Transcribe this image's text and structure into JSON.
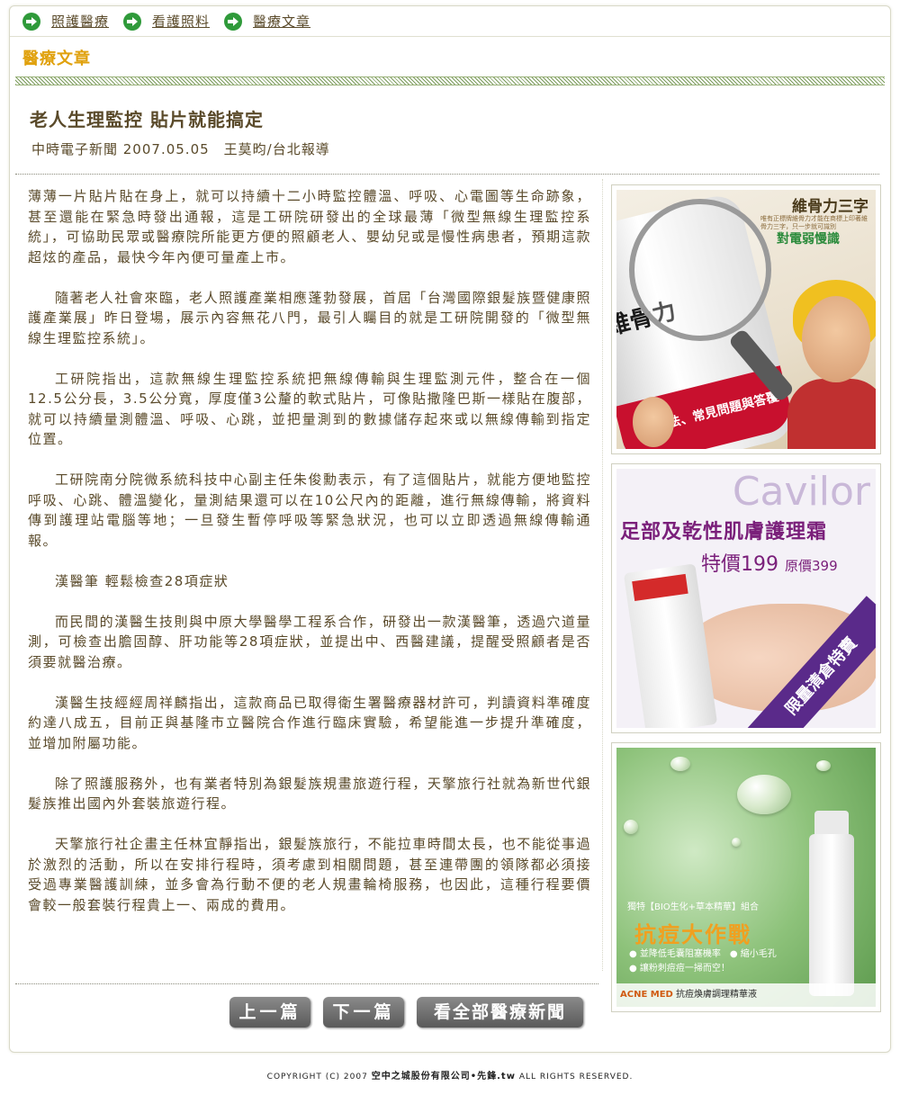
{
  "nav": {
    "items": [
      {
        "label": "照護醫療"
      },
      {
        "label": "看護照料"
      },
      {
        "label": "醫療文章"
      }
    ]
  },
  "section_title": "醫療文章",
  "article": {
    "title": "老人生理監控 貼片就能搞定",
    "byline": "中時電子新聞 2007.05.05　王莫昀/台北報導",
    "paragraphs": [
      "薄薄一片貼片貼在身上，就可以持續十二小時監控體溫、呼吸、心電圖等生命跡象，甚至還能在緊急時發出通報，這是工研院研發出的全球最薄「微型無線生理監控系統」，可協助民眾或醫療院所能更方便的照顧老人、嬰幼兒或是慢性病患者，預期這款超炫的產品，最快今年內便可量產上市。",
      "隨著老人社會來臨，老人照護產業相應蓬勃發展，首屆「台灣國際銀髮族暨健康照護產業展」昨日登場，展示內容無花八門，最引人矚目的就是工研院開發的「微型無線生理監控系統」。",
      "工研院指出，這款無線生理監控系統把無線傳輸與生理監測元件，整合在一個12.5公分長，3.5公分寬，厚度僅3公釐的軟式貼片，可像貼撒隆巴斯一樣貼在腹部，就可以持續量測體溫、呼吸、心跳，並把量測到的數據儲存起來或以無線傳輸到指定位置。",
      "工研院南分院微系統科技中心副主任朱俊勳表示，有了這個貼片，就能方便地監控呼吸、心跳、體溫變化，量測結果還可以在10公尺內的距離，進行無線傳輸，將資料傳到護理站電腦等地；一旦發生暫停呼吸等緊急狀況，也可以立即透過無線傳輸通報。",
      "漢醫筆 輕鬆檢查28項症狀",
      "而民間的漢醫生技則與中原大學醫學工程系合作，研發出一款漢醫筆，透過穴道量測，可檢查出膽固醇、肝功能等28項症狀，並提出中、西醫建議，提醒受照顧者是否須要就醫治療。",
      "漢醫生技經經周祥麟指出，這款商品已取得衛生署醫療器材許可，判讀資料準確度約達八成五，目前正與基隆市立醫院合作進行臨床實驗，希望能進一步提升準確度，並增加附屬功能。",
      "除了照護服務外，也有業者特別為銀髮族規畫旅遊行程，天擎旅行社就為新世代銀髮族推出國內外套裝旅遊行程。",
      "天擎旅行社企畫主任林宜靜指出，銀髮族旅行，不能拉車時間太長，也不能從事過於激烈的活動，所以在安排行程時，須考慮到相關問題，甚至連帶團的領隊都必須接受過專業醫護訓練，並多會為行動不便的老人規畫輪椅服務，也因此，這種行程要價會較一般套裝行程貴上一、兩成的費用。"
    ]
  },
  "ads": {
    "ad1": {
      "headline": "維骨力三字",
      "fine_print": "唯有正標牌維骨力才能在商標上印著維骨力三字，只一步就可識別",
      "subhead": "對電弱慢識",
      "bottle_brand": "維骨力",
      "bottle_band": "用法、常見問題與答覆"
    },
    "ad2": {
      "brand": "Cavilor",
      "line1": "足部及乾性肌膚護理霜",
      "price": "特價199",
      "orig_price": "原價399",
      "ribbon": "限量清倉特賣"
    },
    "ad3": {
      "tag": "獨特【BIO生化+草本精華】組合",
      "headline": "抗痘大作戰",
      "bullet1": "● 並降低毛囊阻塞機率　● 縮小毛孔",
      "bullet2": "● 讓粉刺痘痘一掃而空！",
      "brand": "ACNE MED",
      "product": "抗痘煥膚調理精華液"
    }
  },
  "buttons": {
    "prev": "上一篇",
    "next": "下一篇",
    "all": "看全部醫療新聞"
  },
  "footer": {
    "prefix": "COPYRIGHT (C) 2007",
    "company": "空中之城股份有限公司",
    "site": "先鋒.tw",
    "suffix": "ALL RIGHTS RESERVED."
  }
}
